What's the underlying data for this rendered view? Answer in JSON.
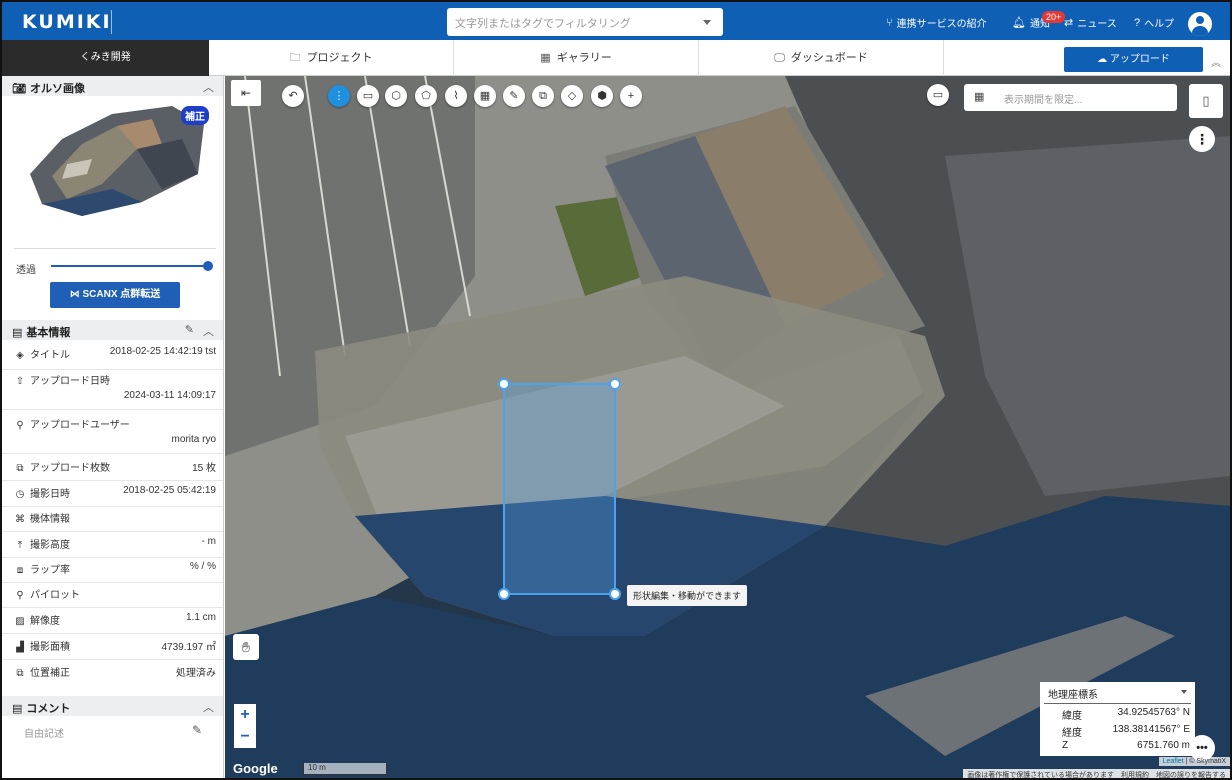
{
  "header": {
    "logo": "KUMIKI",
    "search_placeholder": "文字列またはタグでフィルタリング",
    "links": {
      "services": "連携サービスの紹介",
      "notifications": "通知",
      "notifications_badge": "20+",
      "news": "ニュース",
      "help": "ヘルプ"
    }
  },
  "nav": {
    "project_name": "くみき開発",
    "tabs": [
      "プロジェクト",
      "ギャラリー",
      "ダッシュボード"
    ],
    "upload_label": "アップロード"
  },
  "sidebar": {
    "ortho": {
      "title": "オルソ画像",
      "badge": "補正",
      "opacity_label": "透過",
      "opacity_value": 1.0,
      "scanx_label": "SCANX 点群転送"
    },
    "basic_info": {
      "title": "基本情報",
      "rows": [
        {
          "icon": "layers-icon",
          "key": "タイトル",
          "value": "2018-02-25 14:42:19 tst"
        },
        {
          "icon": "upload-icon",
          "key": "アップロード日時",
          "value": "2024-03-11 14:09:17"
        },
        {
          "icon": "user-icon",
          "key": "アップロードユーザー",
          "value": "morita ryo"
        },
        {
          "icon": "images-icon",
          "key": "アップロード枚数",
          "value": "15 枚"
        },
        {
          "icon": "clock-icon",
          "key": "撮影日時",
          "value": "2018-02-25 05:42:19"
        },
        {
          "icon": "drone-icon",
          "key": "機体情報",
          "value": ""
        },
        {
          "icon": "altitude-icon",
          "key": "撮影高度",
          "value": "- m"
        },
        {
          "icon": "overlap-icon",
          "key": "ラップ率",
          "value": "% / %"
        },
        {
          "icon": "pilot-icon",
          "key": "パイロット",
          "value": ""
        },
        {
          "icon": "resolution-icon",
          "key": "解像度",
          "value": "1.1 cm"
        },
        {
          "icon": "area-icon",
          "key": "撮影面積",
          "value": "4739.197 ㎡"
        },
        {
          "icon": "position-icon",
          "key": "位置補正",
          "value": "処理済み"
        }
      ]
    },
    "comment": {
      "title": "コメント",
      "placeholder": "自由記述"
    }
  },
  "map": {
    "toolbar_icons": [
      "undo-icon",
      "more-vertical-icon",
      "ruler-icon",
      "polygon-point-icon",
      "polygon-icon",
      "polyline-icon",
      "grid-icon",
      "edit-icon",
      "copy-icon",
      "eraser-icon",
      "cube-icon",
      "add-icon"
    ],
    "date_filter_placeholder": "表示期間を限定...",
    "tooltip": "形状編集・移動ができます",
    "google_label": "Google",
    "scale_label": "10 m",
    "coord": {
      "system": "地理座標系",
      "lat_label": "緯度",
      "lat_value": "34.92545763° N",
      "lon_label": "経度",
      "lon_value": "138.38141567° E",
      "z_label": "Z",
      "z_value": "6751.760 m"
    },
    "attribution": "Leaflet | © SkymatiX",
    "attribution_leaflet": "Leaflet",
    "attribution_rest": "| © SkymatiX",
    "attribution2": "画像は著作権で保護されている場合があります　利用規約　地図の誤りを報告する"
  }
}
